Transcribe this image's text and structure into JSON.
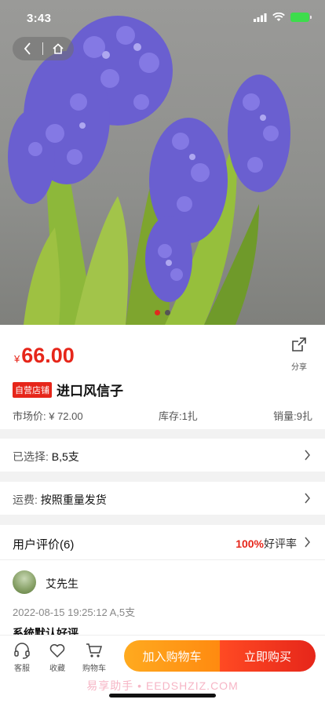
{
  "status_bar": {
    "time": "3:43"
  },
  "colors": {
    "accent": "#e6261a",
    "cart_button": "#ff9a18",
    "flower": "#6a5fd0",
    "stem": "#7aa62a"
  },
  "hero": {
    "icon": "hyacinth-photo",
    "dots_count": 2,
    "active_dot": 1
  },
  "price": {
    "currency": "¥",
    "amount": "66.00"
  },
  "share": {
    "label": "分享"
  },
  "product": {
    "badge": "自营店铺",
    "title": "进口风信子",
    "market_price": "市场价: ¥ 72.00",
    "stock": "库存:1扎",
    "sales": "销量:9扎"
  },
  "selection": {
    "label": "已选择:",
    "value": "B,5支"
  },
  "shipping": {
    "label": "运费:",
    "value": "按照重量发货"
  },
  "reviews": {
    "title": "用户评价(6)",
    "rate_pct": "100%",
    "rate_label": "好评率",
    "author": "艾先生",
    "date": "2022-08-15 19:25:12 A,5支",
    "text": "系统默认好评"
  },
  "bottom_bar": {
    "service_label": "客服",
    "favorite_label": "收藏",
    "cart_label": "购物车",
    "add_to_cart": "加入购物车",
    "buy_now": "立即购买",
    "watermark": "易享助手 • EEDSHZIZ.COM"
  }
}
